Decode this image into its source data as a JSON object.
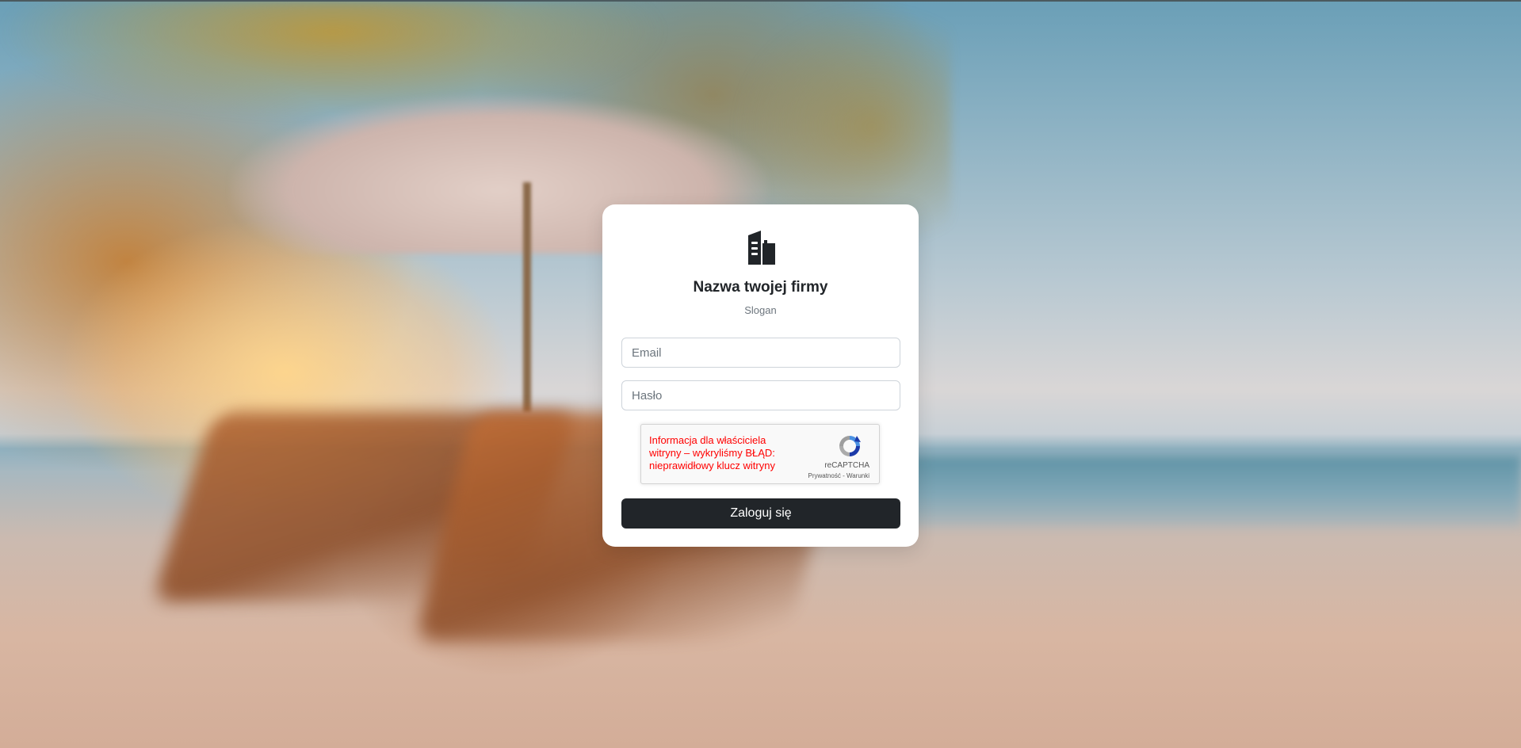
{
  "brand": {
    "title": "Nazwa twojej firmy",
    "slogan": "Slogan",
    "logo_icon": "building-icon"
  },
  "form": {
    "email_placeholder": "Email",
    "password_placeholder": "Hasło",
    "submit_label": "Zaloguj się"
  },
  "recaptcha": {
    "error_text": "Informacja dla właściciela witryny – wykryliśmy BŁĄD: nieprawidłowy klucz witryny",
    "brand_label": "reCAPTCHA",
    "privacy_label": "Prywatność",
    "separator": " - ",
    "terms_label": "Warunki",
    "error_color": "#ff0000"
  },
  "colors": {
    "primary_button": "#212529",
    "card_background": "#ffffff",
    "text_dark": "#212529",
    "text_muted": "#6c757d"
  }
}
